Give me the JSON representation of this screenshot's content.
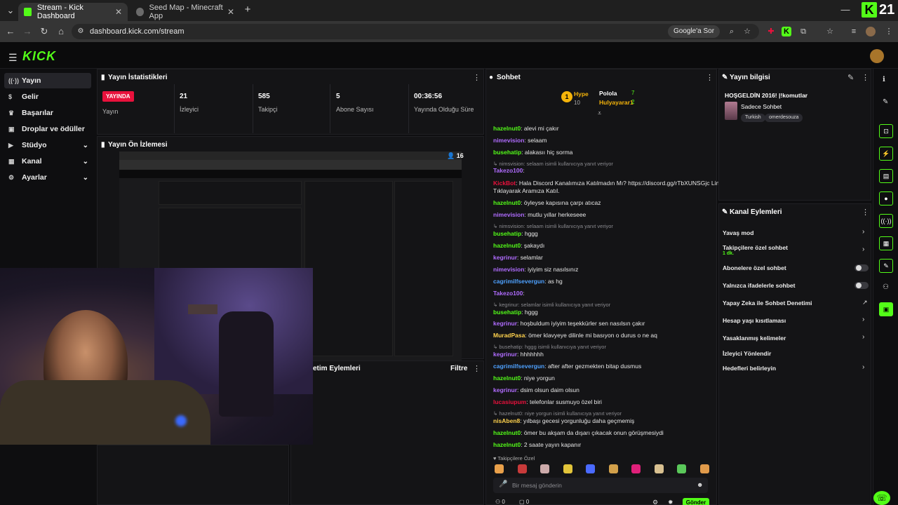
{
  "browser": {
    "tabs": [
      {
        "title": "Stream - Kick Dashboard",
        "active": true
      },
      {
        "title": "Seed Map - Minecraft App",
        "active": false
      }
    ],
    "url": "dashboard.kick.com/stream",
    "google_search_label": "Google'a Sor",
    "top_right_count": "21"
  },
  "header": {
    "logo": "KICK"
  },
  "sidebar": {
    "items": [
      {
        "label": "Yayın",
        "icon": "stream-icon",
        "active": true
      },
      {
        "label": "Gelir",
        "icon": "money-icon"
      },
      {
        "label": "Başarılar",
        "icon": "trophy-icon"
      },
      {
        "label": "Droplar ve ödüller",
        "icon": "gift-icon"
      },
      {
        "label": "Stüdyo",
        "icon": "studio-icon",
        "expandable": true
      },
      {
        "label": "Kanal",
        "icon": "channel-icon",
        "expandable": true
      },
      {
        "label": "Ayarlar",
        "icon": "gear-icon",
        "expandable": true
      }
    ]
  },
  "stats": {
    "title": "Yayın İstatistikleri",
    "live_badge": "YAYINDA",
    "live_label": "Yayın",
    "items": [
      {
        "value": "21",
        "label": "İzleyici"
      },
      {
        "value": "585",
        "label": "Takipçi"
      },
      {
        "value": "5",
        "label": "Abone Sayısı"
      },
      {
        "value": "00:36:56",
        "label": "Yayında Olduğu Süre"
      }
    ]
  },
  "preview": {
    "title": "Yayın Ön İzlemesi",
    "viewer_count": "16"
  },
  "mod_actions": {
    "title_partial": "etim Eylemleri",
    "filter": "Filtre"
  },
  "chat": {
    "title": "Sohbet",
    "hype_label": "Hype",
    "hype_count": "10",
    "top_users": [
      {
        "name": "Polola",
        "count": "7"
      },
      {
        "name": "Hulyayarar1",
        "count": "2"
      }
    ],
    "messages": [
      {
        "user": "hazelnut0",
        "text": ": alevi mi çakır",
        "color": "#53fc18"
      },
      {
        "user": "nimevision",
        "text": ": selaam",
        "color": "#b06cff"
      },
      {
        "user": "busehatip",
        "text": ": alakasıı hiç sorma",
        "color": "#53fc18"
      },
      {
        "reply": "nimsvision: selaam isimli kullanıcıya yanıt veriyor"
      },
      {
        "user": "Takezo100",
        "text": ":",
        "color": "#b06cff"
      },
      {
        "user": "KickBot",
        "text": ": Hala Discord Kanalımıza Katılmadın Mı? https://discord.gg/rTbXUNSGjc Linke",
        "color": "#e9113c"
      },
      {
        "cont": "Tıklayarak Aramıza Katıl."
      },
      {
        "user": "hazelnut0",
        "text": ": öyleyse kapısına çarpı atıcaz",
        "color": "#53fc18"
      },
      {
        "user": "nimevision",
        "text": ": mutlu yıllar herkeseee",
        "color": "#b06cff"
      },
      {
        "reply": "nimsvision: selaam isimli kullanıcıya yanıt veriyor"
      },
      {
        "user": "busehatip",
        "text": ": hggg",
        "color": "#53fc18"
      },
      {
        "user": "hazelnut0",
        "text": ": şakaydı",
        "color": "#53fc18"
      },
      {
        "user": "kegrinur",
        "text": ": selamlar",
        "color": "#b06cff"
      },
      {
        "user": "nimevision",
        "text": ": iyiyim siz nasılsınız",
        "color": "#b06cff"
      },
      {
        "user": "cagrimilfsevergun",
        "text": ": as hg",
        "color": "#4ea1ff"
      },
      {
        "user": "Takezo100",
        "text": ":",
        "color": "#b06cff"
      },
      {
        "reply": "kegrinur: selamlar isimli kullanıcıya yanıt veriyor"
      },
      {
        "user": "busehatip",
        "text": ": hggg",
        "color": "#53fc18"
      },
      {
        "user": "kegrinur",
        "text": ": hoşbuldum iyiyim teşekkürler sen nasılsın çakır",
        "color": "#b06cff"
      },
      {
        "user": "MuradPasa",
        "text": ": ömer klavyeye dilinle mi basıyon o durus o ne aq",
        "color": "#ffd24d"
      },
      {
        "reply": "busehatip: hggg isimli kullanıcıya yanıt veriyor"
      },
      {
        "user": "kegrinur",
        "text": ": hhhhhhh",
        "color": "#b06cff"
      },
      {
        "user": "cagrimilfsevergun",
        "text": ": after after gezmekten bitap dusmus",
        "color": "#4ea1ff"
      },
      {
        "user": "hazelnut0",
        "text": ": niye yorgun",
        "color": "#53fc18"
      },
      {
        "user": "kegrinur",
        "text": ": dsim olsun daim olsun",
        "color": "#b06cff"
      },
      {
        "user": "lucasiupum",
        "text": ": telefonlar susmuyo özel biri",
        "color": "#e9113c"
      },
      {
        "reply": "hazelnut0: niye yorgun isimli kullanıcıya yanıt veriyor"
      },
      {
        "user": "nisAben8",
        "text": ": yılbaşı gecesi yorgunluğu daha geçmemiş",
        "color": "#ffd24d"
      },
      {
        "user": "hazelnut0",
        "text": ": ömer bu akşam da dışarı çıkacak onun görüşmesiydi",
        "color": "#53fc18"
      },
      {
        "user": "hazelnut0",
        "text": ": 2 saate yayın kapanır",
        "color": "#53fc18"
      }
    ],
    "followers_only": "Takipçilere Özel",
    "placeholder": "Bir mesaj gönderin",
    "bottom_count_a": "0",
    "bottom_count_b": "0",
    "send": "Gönder"
  },
  "stream_info": {
    "title": "Yayın bilgisi",
    "stream_title": "HOŞGELDİN 2016! |!komutlar",
    "category": "Sadece Sohbet",
    "tags": [
      "Turkish",
      "omerdesouza"
    ]
  },
  "channel_actions": {
    "title": "Kanal Eylemleri",
    "items": [
      {
        "label": "Yavaş mod",
        "control": "chevron"
      },
      {
        "label": "Takipçilere özel sohbet",
        "sub": "1 dk.",
        "control": "chevron"
      },
      {
        "label": "Abonelere özel sohbet",
        "control": "toggle"
      },
      {
        "label": "Yalnızca ifadelerle sohbet",
        "control": "toggle"
      },
      {
        "label": "Yapay Zeka ile Sohbet Denetimi",
        "control": "external"
      },
      {
        "label": "Hesap yaşı kısıtlaması",
        "control": "chevron"
      },
      {
        "label": "Yasaklanmış kelimeler",
        "control": "chevron"
      },
      {
        "label": "İzleyici Yönlendir",
        "control": "none"
      },
      {
        "label": "Hedefleri belirleyin",
        "control": "chevron"
      }
    ]
  }
}
